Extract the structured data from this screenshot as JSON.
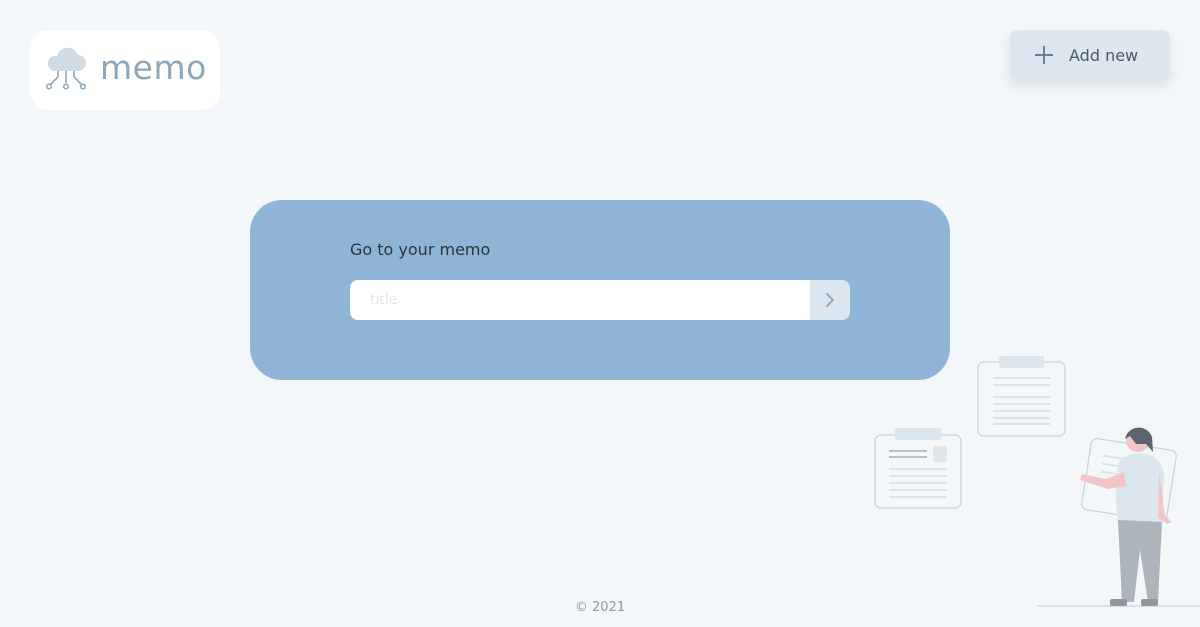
{
  "app": {
    "name": "memo",
    "logo_icon": "cloud-network-icon"
  },
  "header": {
    "add_button": {
      "label": "Add new",
      "icon": "plus-icon"
    }
  },
  "main": {
    "heading": "Go to your memo",
    "search": {
      "placeholder": "title",
      "value": "",
      "submit_icon": "chevron-right-icon"
    }
  },
  "footer": {
    "text": "© 2021"
  },
  "colors": {
    "background": "#f4f7fa",
    "panel": "#8fb4d5",
    "button": "#dbe6ef",
    "logo_text": "#8da6b8"
  }
}
